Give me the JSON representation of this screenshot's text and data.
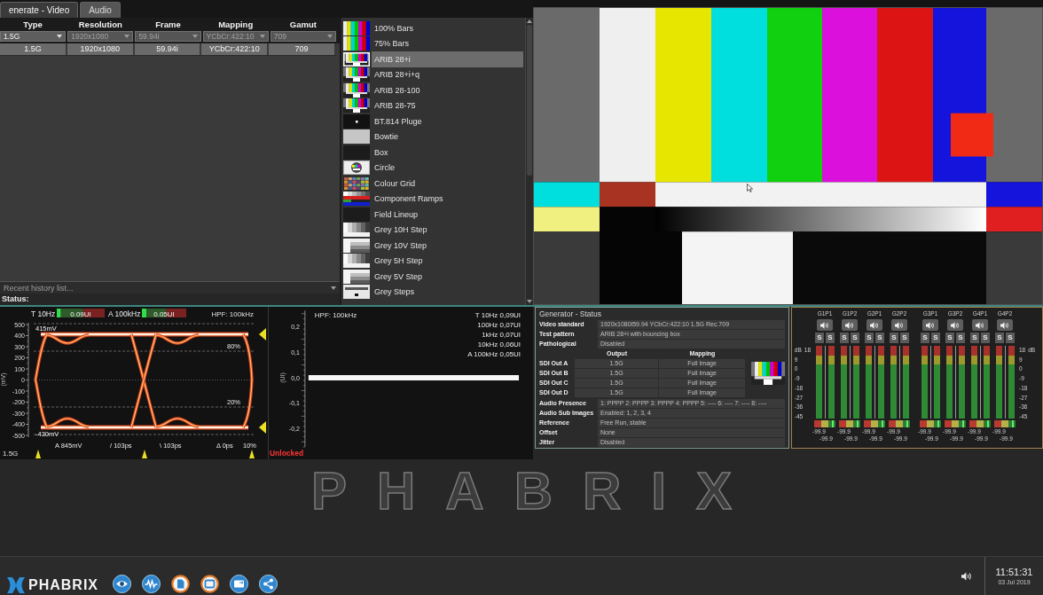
{
  "tabs": [
    {
      "label": "enerate - Video",
      "selected": true
    },
    {
      "label": "Audio",
      "selected": false
    }
  ],
  "format_table": {
    "columns": [
      "Type",
      "Resolution",
      "Frame",
      "Mapping",
      "Gamut"
    ],
    "filters": [
      {
        "value": "1.5G",
        "disabled": false
      },
      {
        "value": "1920x1080",
        "disabled": true
      },
      {
        "value": "59.94i",
        "disabled": true
      },
      {
        "value": "YCbCr:422:10",
        "disabled": true
      },
      {
        "value": "709",
        "disabled": true
      }
    ],
    "rows": [
      {
        "cells": [
          "1.5G",
          "1920x1080",
          "59.94i",
          "YCbCr:422:10",
          "709"
        ],
        "selected": true
      }
    ]
  },
  "history": {
    "placeholder": "Recent history list..."
  },
  "status_label": "Status:",
  "patterns": [
    {
      "label": "100% Bars",
      "kind": "bars",
      "selected": false
    },
    {
      "label": "75% Bars",
      "kind": "bars",
      "selected": false
    },
    {
      "label": "ARIB 28+i",
      "kind": "arib",
      "selected": true
    },
    {
      "label": "ARIB 28+i+q",
      "kind": "arib",
      "selected": false
    },
    {
      "label": "ARIB 28-100",
      "kind": "arib",
      "selected": false
    },
    {
      "label": "ARIB 28-75",
      "kind": "arib",
      "selected": false
    },
    {
      "label": "BT.814 Pluge",
      "kind": "pluge",
      "selected": false
    },
    {
      "label": "Bowtie",
      "kind": "flat",
      "selected": false
    },
    {
      "label": "Box",
      "kind": "dark",
      "selected": false
    },
    {
      "label": "Circle",
      "kind": "circle",
      "selected": false
    },
    {
      "label": "Colour Grid",
      "kind": "grid",
      "selected": false
    },
    {
      "label": "Component Ramps",
      "kind": "ramps",
      "selected": false
    },
    {
      "label": "Field Lineup",
      "kind": "dark",
      "selected": false
    },
    {
      "label": "Grey 10H Step",
      "kind": "hsteps",
      "selected": false
    },
    {
      "label": "Grey 10V Step",
      "kind": "vsteps",
      "selected": false
    },
    {
      "label": "Grey 5H Step",
      "kind": "hsteps",
      "selected": false
    },
    {
      "label": "Grey 5V Step",
      "kind": "vsteps",
      "selected": false
    },
    {
      "label": "Grey Steps",
      "kind": "steps",
      "selected": false
    }
  ],
  "eye_diagram": {
    "jitter_meters": [
      {
        "label": "T 10Hz",
        "reading": "0.09UI",
        "level": 0.08
      },
      {
        "label": "A 100kHz",
        "reading": "0.05UI",
        "level": 0.1
      }
    ],
    "filter": "HPF: 100kHz",
    "y_unit": "(mV)",
    "y_ticks": [
      "500",
      "400",
      "300",
      "200",
      "100",
      "0",
      "-100",
      "-200",
      "-300",
      "-400",
      "-500"
    ],
    "high_level": "415mV",
    "low_level": "-430mV",
    "threshold_labels": [
      "80%",
      "20%",
      "10%"
    ],
    "measurements": [
      "A 845mV",
      "/ 103ps",
      "\\ 103ps",
      "Δ 0ps"
    ],
    "rate": "1.5G"
  },
  "jitter_graph": {
    "filter": "HPF: 100kHz",
    "readings": [
      "T 10Hz 0,09UI",
      "100Hz 0,07UI",
      "1kHz 0,07UI",
      "10kHz 0,06UI",
      "A 100kHz 0,05UI"
    ],
    "y_unit": "(UI)",
    "y_ticks": [
      "0,2",
      "0,1",
      "0,0",
      "-0,1",
      "-0,2"
    ],
    "lock_status": "Unlocked"
  },
  "generator_status": {
    "title": "Generator - Status",
    "fields": [
      {
        "label": "Video standard",
        "value": "1920x1080i59.94 YCbCr:422:10 1.5G Rec.709"
      },
      {
        "label": "Test pattern",
        "value": "ARIB 28+i with bouncing box"
      },
      {
        "label": "Pathological",
        "value": "Disabled"
      }
    ],
    "outputs": {
      "columns": [
        "Output",
        "Mapping"
      ],
      "rows": [
        {
          "label": "SDI Out A",
          "output": "1.5G",
          "mapping": "Full Image"
        },
        {
          "label": "SDI Out B",
          "output": "1.5G",
          "mapping": "Full Image"
        },
        {
          "label": "SDI Out C",
          "output": "1.5G",
          "mapping": "Full Image"
        },
        {
          "label": "SDI Out D",
          "output": "1.5G",
          "mapping": "Full Image"
        }
      ]
    },
    "details": [
      {
        "label": "Audio Presence",
        "value": "1: PPPP 2: PPPP 3: PPPP 4: PPPP 5: ---- 6: ---- 7: ---- 8: ----"
      },
      {
        "label": "Audio Sub Images",
        "value": "Enabled: 1, 2, 3, 4"
      },
      {
        "label": "Reference",
        "value": "Free Run, stable"
      },
      {
        "label": "Offset",
        "value": "None"
      },
      {
        "label": "Jitter",
        "value": "Disabled"
      }
    ]
  },
  "audio_meters": {
    "left_scale": {
      "unit": "dB",
      "ticks": [
        "18",
        "9",
        "0",
        "-9",
        "-18",
        "-27",
        "-36",
        "-45"
      ]
    },
    "right_scale": {
      "unit": "dB",
      "ticks": [
        "18",
        "9",
        "0",
        "-9",
        "-18",
        "-27",
        "-36",
        "-45"
      ]
    },
    "channels": [
      {
        "label": "G1P1",
        "solo_buttons": [
          "S",
          "S"
        ],
        "readings": [
          "-99.9",
          "-99.9"
        ]
      },
      {
        "label": "G1P2",
        "solo_buttons": [
          "S",
          "S"
        ],
        "readings": [
          "-99.9",
          "-99.9"
        ]
      },
      {
        "label": "G2P1",
        "solo_buttons": [
          "S",
          "S"
        ],
        "readings": [
          "-99.9",
          "-99.9"
        ]
      },
      {
        "label": "G2P2",
        "solo_buttons": [
          "S",
          "S"
        ],
        "readings": [
          "-99.9",
          "-99.9"
        ]
      },
      {
        "label": "G3P1",
        "solo_buttons": [
          "S",
          "S"
        ],
        "readings": [
          "-99.9",
          "-99.9"
        ]
      },
      {
        "label": "G3P2",
        "solo_buttons": [
          "S",
          "S"
        ],
        "readings": [
          "-99.9",
          "-99.9"
        ]
      },
      {
        "label": "G4P1",
        "solo_buttons": [
          "S",
          "S"
        ],
        "readings": [
          "-99.9",
          "-99.9"
        ]
      },
      {
        "label": "G4P2",
        "solo_buttons": [
          "S",
          "S"
        ],
        "readings": [
          "-99.9",
          "-99.9"
        ]
      }
    ]
  },
  "background_logo": "PHABRIX",
  "taskbar": {
    "logo": "PHABRIX",
    "clock": {
      "time": "11:51:31",
      "date": "03 Jul 2019"
    }
  }
}
